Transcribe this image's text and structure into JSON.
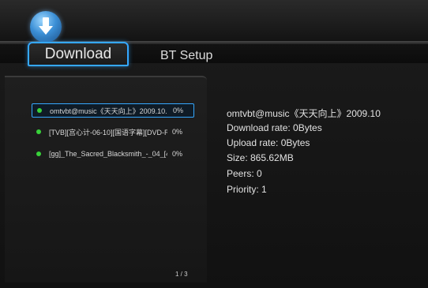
{
  "tabs": {
    "download": "Download",
    "bt_setup": "BT Setup"
  },
  "icons": {
    "app": "download-arrow-icon",
    "status": "green-dot-icon"
  },
  "colors": {
    "accent": "#35a8ff",
    "active_dot": "#38d23a"
  },
  "list": {
    "items": [
      {
        "name": "omtvbt@music《天天向上》2009.10.",
        "percent": "0%"
      },
      {
        "name": "[TVB][宫心计-06-10][国语字幕][DVD-R",
        "percent": "0%"
      },
      {
        "name": "[gg]_The_Sacred_Blacksmith_-_04_[4",
        "percent": "0%"
      }
    ],
    "page": "1 / 3"
  },
  "details": {
    "title": "omtvbt@music《天天向上》2009.10",
    "download_rate": "Download rate: 0Bytes",
    "upload_rate": "Upload rate: 0Bytes",
    "size": "Size: 865.62MB",
    "peers": "Peers: 0",
    "priority": "Priority: 1"
  }
}
